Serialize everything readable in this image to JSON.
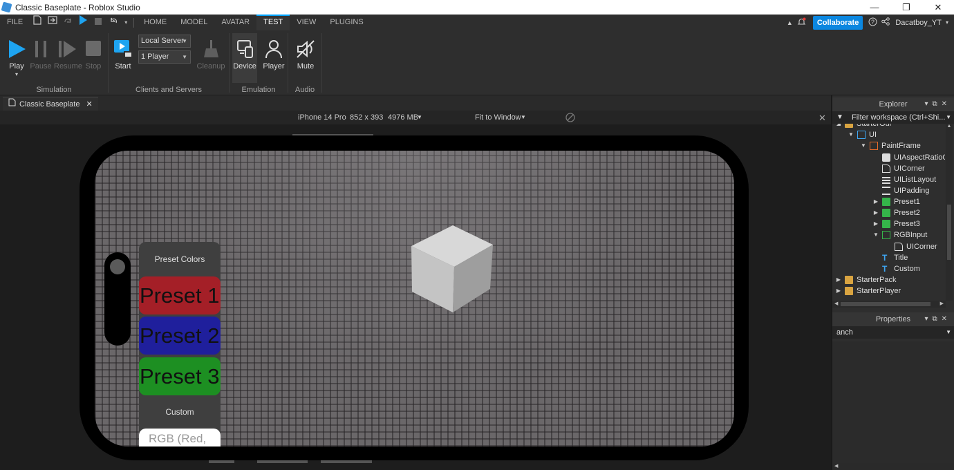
{
  "window": {
    "title": "Classic Baseplate - Roblox Studio",
    "minimize": "—",
    "maximize": "❐",
    "close": "✕"
  },
  "menu": {
    "file": "FILE",
    "tabs": [
      "HOME",
      "MODEL",
      "AVATAR",
      "TEST",
      "VIEW",
      "PLUGINS"
    ],
    "active_tab": "TEST",
    "collaborate": "Collaborate",
    "user": "Dacatboy_YT"
  },
  "ribbon": {
    "play": "Play",
    "pause": "Pause",
    "resume": "Resume",
    "stop": "Stop",
    "simulation": "Simulation",
    "server_mode": "Local Server",
    "players": "1 Player",
    "start": "Start",
    "cleanup": "Cleanup",
    "clients_servers": "Clients and Servers",
    "device": "Device",
    "player": "Player",
    "emulation": "Emulation",
    "mute": "Mute",
    "audio": "Audio"
  },
  "doc_tab": {
    "label": "Classic Baseplate",
    "close": "✕"
  },
  "device_bar": {
    "device": "iPhone 14 Pro",
    "resolution": "852 x 393",
    "memory": "4976 MB",
    "fit": "Fit to Window"
  },
  "game_ui": {
    "title": "Preset Colors",
    "presets": [
      {
        "label": "Preset 1",
        "color": "#a41f27"
      },
      {
        "label": "Preset 2",
        "color": "#1f1f9c"
      },
      {
        "label": "Preset 3",
        "color": "#1d8f22"
      }
    ],
    "custom": "Custom",
    "rgb_placeholder": "RGB (Red,"
  },
  "explorer": {
    "title": "Explorer",
    "filter_placeholder": "Filter workspace (Ctrl+Shi...",
    "items": [
      {
        "label": "StarterGui",
        "icon": "folder-icon"
      },
      {
        "label": "UI",
        "icon": "screengui-icon"
      },
      {
        "label": "PaintFrame",
        "icon": "frame-icon"
      },
      {
        "label": "UIAspectRatioC",
        "icon": "aspect-icon"
      },
      {
        "label": "UICorner",
        "icon": "corner-icon"
      },
      {
        "label": "UIListLayout",
        "icon": "list-icon"
      },
      {
        "label": "UIPadding",
        "icon": "padding-icon"
      },
      {
        "label": "Preset1",
        "icon": "button-icon"
      },
      {
        "label": "Preset2",
        "icon": "button-icon"
      },
      {
        "label": "Preset3",
        "icon": "button-icon"
      },
      {
        "label": "RGBInput",
        "icon": "textbox-icon"
      },
      {
        "label": "UICorner",
        "icon": "corner-icon"
      },
      {
        "label": "Title",
        "icon": "textlabel-icon"
      },
      {
        "label": "Custom",
        "icon": "textlabel-icon"
      },
      {
        "label": "StarterPack",
        "icon": "folder-icon"
      },
      {
        "label": "StarterPlayer",
        "icon": "folder-icon"
      }
    ]
  },
  "properties": {
    "title": "Properties",
    "filter_value": "anch"
  },
  "colors": {
    "accent": "#00a2ff",
    "collaborate": "#0b87e0",
    "play": "#1ea4f1"
  }
}
